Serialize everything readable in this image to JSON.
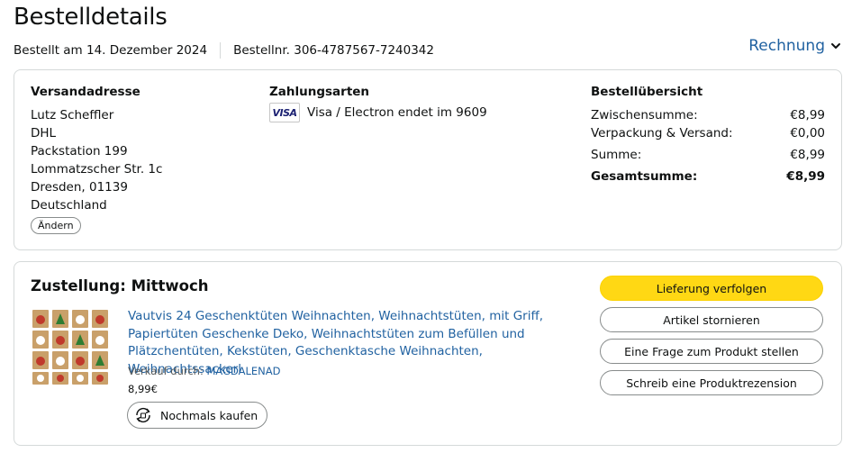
{
  "page": {
    "title": "Bestelldetails",
    "ordered_on": "Bestellt am 14. Dezember 2024",
    "order_number": "Bestellnr. 306-4787567-7240342",
    "invoice_label": "Rechnung"
  },
  "shipping": {
    "heading": "Versandadresse",
    "lines": [
      "Lutz Scheffler",
      "DHL",
      "Packstation 199",
      "Lommatzscher Str. 1c",
      "Dresden, 01139",
      "Deutschland"
    ],
    "change_label": "Ändern"
  },
  "payment": {
    "heading": "Zahlungsarten",
    "card_logo": "VISA",
    "card_text": "Visa / Electron endet im 9609"
  },
  "summary": {
    "heading": "Bestellübersicht",
    "rows": [
      {
        "label": "Zwischensumme:",
        "value": "€8,99"
      },
      {
        "label": "Verpackung & Versand:",
        "value": "€0,00"
      },
      {
        "label": "Summe:",
        "value": "€8,99"
      },
      {
        "label": "Gesamtsumme:",
        "value": "€8,99"
      }
    ]
  },
  "shipment": {
    "heading": "Zustellung: Mittwoch",
    "product_title": "Vautvis 24 Geschenktüten Weihnachten, Weihnachtstüten, mit Griff, Papiertüten Geschenke Deko, Weihnachtstüten zum Befüllen und Plätzchentüten, Kekstüten, Geschenktasche Weihnachten, Weihnachtssackerl",
    "seller_prefix": "Verkauf durch: ",
    "seller_name": "MAGDALENAD",
    "price": "8,99€",
    "rebuy_label": "Nochmals kaufen",
    "image_icon": "christmas-gift-bags-thumbnail"
  },
  "actions": {
    "track": "Lieferung verfolgen",
    "cancel": "Artikel stornieren",
    "question": "Eine Frage zum Produkt stellen",
    "review": "Schreib eine Produktrezension"
  },
  "colors": {
    "link": "#2162a1",
    "primary_button": "#ffd814",
    "border": "#d5d9d9"
  }
}
